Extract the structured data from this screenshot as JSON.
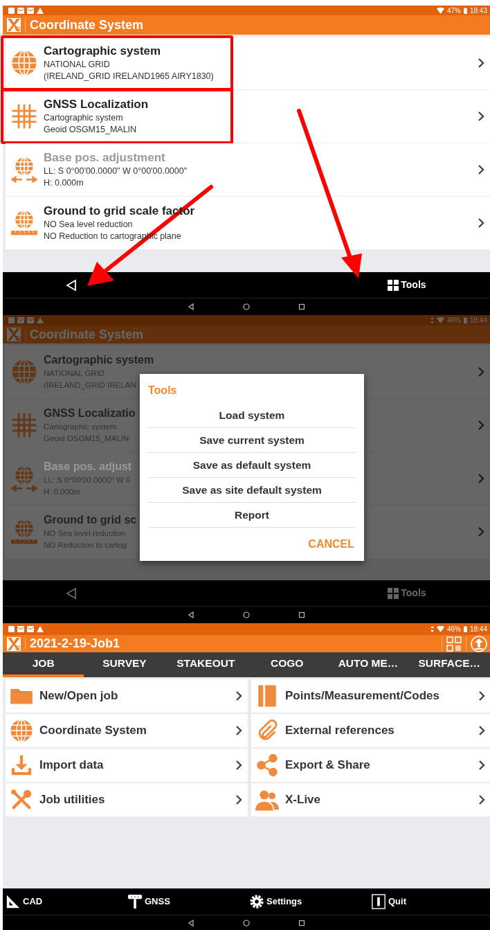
{
  "screens": [
    {
      "kind": "list",
      "status_bar": {
        "data_activity": false,
        "battery": "47%",
        "time": "18:43"
      },
      "title": "Coordinate System",
      "annotation_arrows": true,
      "items": [
        {
          "kind": "globe",
          "title": "Cartographic system",
          "lines": [
            "NATIONAL GRID",
            "(IRELAND_GRID IRELAND1965 AIRY1830)"
          ],
          "disabled": false,
          "highlighted": true
        },
        {
          "kind": "grid",
          "title": "GNSS Localization",
          "lines": [
            "Cartographic system",
            "Geoid OSGM15_MALIN"
          ],
          "disabled": false,
          "highlighted": true
        },
        {
          "kind": "globe-arrows",
          "title": "Base pos. adjustment",
          "lines": [
            "LL: S 0°00'00.0000\"  W 0°00'00.0000\"",
            "H: 0.000m"
          ],
          "disabled": true,
          "highlighted": false
        },
        {
          "kind": "globe-ruler",
          "title": "Ground to grid scale factor",
          "lines": [
            "NO Sea level reduction",
            "NO Reduction to cartographic plane"
          ],
          "disabled": false,
          "highlighted": false
        }
      ],
      "tools_label": "Tools"
    },
    {
      "kind": "list",
      "status_bar": {
        "data_activity": true,
        "battery": "46%",
        "time": "18:44"
      },
      "title": "Coordinate System",
      "annotation_arrows": false,
      "items": [
        {
          "kind": "globe",
          "title": "Cartographic system",
          "lines": [
            "NATIONAL GRID",
            "(IRELAND_GRID IRELAN"
          ],
          "disabled": false,
          "highlighted": false
        },
        {
          "kind": "grid",
          "title": "GNSS Localizatio",
          "lines": [
            "Cartographic system",
            "Geoid OSGM15_MALIN"
          ],
          "disabled": false,
          "highlighted": false
        },
        {
          "kind": "globe-arrows",
          "title": "Base pos. adjust",
          "lines": [
            "LL: S 0°00'00.0000\"  W 0",
            "H: 0.000m"
          ],
          "disabled": true,
          "highlighted": false
        },
        {
          "kind": "globe-ruler",
          "title": "Ground to grid sc",
          "lines": [
            "NO Sea level reduction",
            "NO Reduction to cartog"
          ],
          "disabled": false,
          "highlighted": false
        }
      ],
      "tools_label": "Tools",
      "dialog": {
        "title": "Tools",
        "options": [
          "Load system",
          "Save current system",
          "Save as default system",
          "Save as site default system",
          "Report"
        ],
        "cancel": "CANCEL"
      }
    },
    {
      "kind": "job-menu",
      "status_bar": {
        "data_activity": true,
        "battery": "46%",
        "time": "18:44"
      },
      "title": "2021-2-19-Job1",
      "tabs": [
        {
          "label": "JOB",
          "selected": true
        },
        {
          "label": "SURVEY",
          "selected": false
        },
        {
          "label": "STAKEOUT",
          "selected": false
        },
        {
          "label": "COGO",
          "selected": false
        },
        {
          "label": "AUTO ME…",
          "selected": false
        },
        {
          "label": "SURFACE…",
          "selected": false
        }
      ],
      "menu": [
        {
          "kind": "folder",
          "label": "New/Open job"
        },
        {
          "kind": "book",
          "label": "Points/Measurement/Codes"
        },
        {
          "kind": "globe",
          "label": "Coordinate System"
        },
        {
          "kind": "paperclip",
          "label": "External references"
        },
        {
          "kind": "download",
          "label": "Import data"
        },
        {
          "kind": "share",
          "label": "Export & Share"
        },
        {
          "kind": "tools",
          "label": "Job utilities"
        },
        {
          "kind": "people",
          "label": "X-Live"
        }
      ],
      "toolbar": [
        {
          "kind": "set-square",
          "label": "CAD"
        },
        {
          "kind": "receiver",
          "label": "GNSS"
        },
        {
          "kind": "gear",
          "label": "Settings"
        },
        {
          "kind": "quit",
          "label": "Quit"
        }
      ]
    }
  ]
}
